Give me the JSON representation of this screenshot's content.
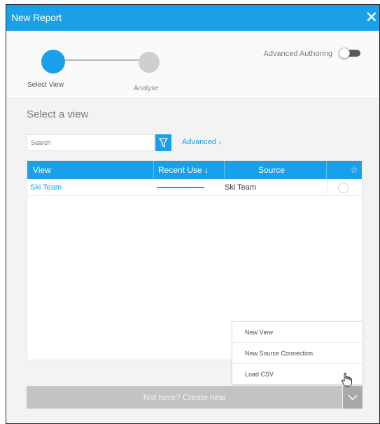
{
  "dialog": {
    "title": "New Report",
    "close_icon": "close-icon"
  },
  "stepper": {
    "steps": [
      {
        "label": "Select View",
        "state": "active"
      },
      {
        "label": "Analyse",
        "state": "inactive"
      }
    ],
    "advanced_authoring_label": "Advanced Authoring",
    "advanced_authoring_on": false
  },
  "select_view": {
    "title": "Select a view",
    "search": {
      "placeholder": "Search",
      "value": ""
    },
    "filter_icon": "filter-icon",
    "advanced_link": "Advanced ↓"
  },
  "table": {
    "columns": {
      "view": "View",
      "recent": "Recent Use ↓",
      "source": "Source",
      "star": "☆"
    },
    "rows": [
      {
        "view": "Ski Team",
        "recent_use_level": 1.0,
        "source": "Ski Team",
        "favorite": false
      }
    ]
  },
  "create_menu": {
    "items": [
      "New View",
      "New Source Connection",
      "Load CSV"
    ]
  },
  "create_bar": {
    "label": "Not here? Create new",
    "caret_icon": "chevron-down-icon"
  },
  "colors": {
    "accent": "#1aa0e8",
    "create_bar": "#c3c3c3",
    "create_caret": "#a9a9a9"
  }
}
